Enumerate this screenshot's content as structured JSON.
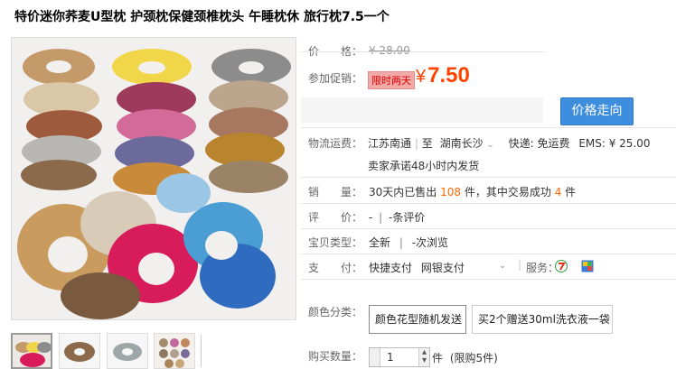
{
  "title": "特价迷你荞麦U型枕 护颈枕保健颈椎枕头 午睡枕休 旅行枕7.5一个",
  "price_label": "价　　格：",
  "original_price": "¥ 28.00",
  "promo_label": "参加促销：",
  "promo_tag": "限时两天",
  "promo_currency": "¥",
  "promo_price": "7.50",
  "trend_button": "价格走向",
  "shipping": {
    "label": "物流运费：",
    "from": "江苏南通",
    "to_label": "至",
    "to": "湖南长沙",
    "dropdown": "⌄",
    "express": "快递: 免运费",
    "ems": "EMS: ¥ 25.00",
    "promise": "卖家承诺48小时内发货"
  },
  "sales": {
    "label": "销　　量：",
    "prefix": "30天内已售出",
    "count": "108",
    "mid": "件，其中交易成功",
    "success": "4",
    "suffix": "件"
  },
  "review": {
    "label": "评　　价：",
    "score": "-",
    "sep": "|",
    "count": "-条评价"
  },
  "item_type": {
    "label": "宝贝类型：",
    "type": "全新",
    "sep": "|",
    "views": "-次浏览"
  },
  "payment": {
    "label": "支　　付：",
    "quick": "快捷支付",
    "bank": "网银支付",
    "dropdown": "⌄",
    "service_label": "服务："
  },
  "colors": {
    "label": "颜色分类：",
    "options": [
      "颜色花型随机发送",
      "买2个赠送30ml洗衣液一袋"
    ]
  },
  "quantity": {
    "label": "购买数量：",
    "value": "1",
    "unit": "件",
    "limit": "(限购5件)"
  },
  "palette": {
    "price": "#ff4400",
    "button": "#3e8ee0",
    "promo_bg": "#f2aaa8"
  }
}
